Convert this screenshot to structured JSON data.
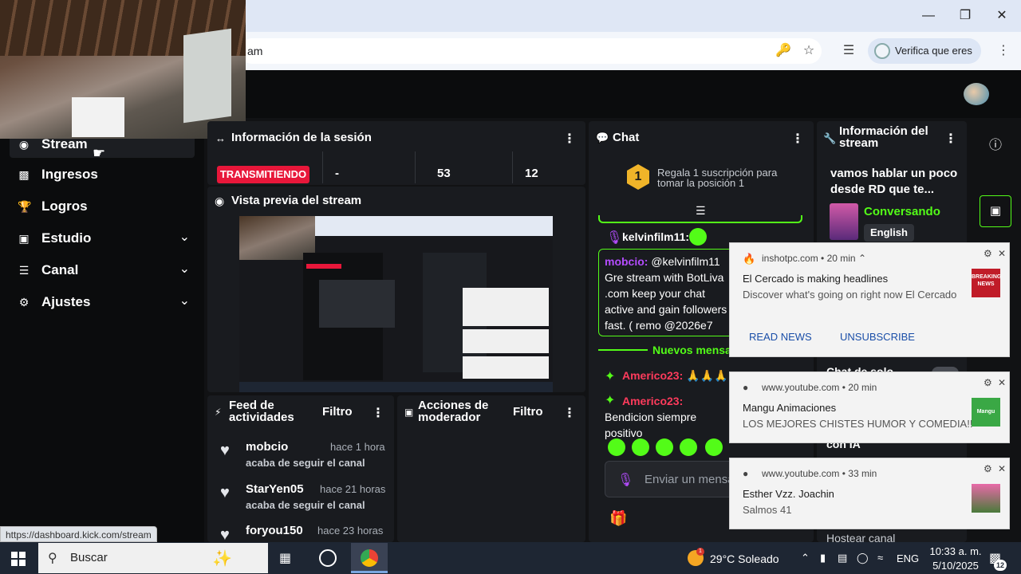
{
  "browser": {
    "url_fragment": "am",
    "verify_label": "Verifica que eres tú",
    "window_controls": [
      "minimize",
      "restore",
      "close"
    ],
    "status_url": "https://dashboard.kick.com/stream"
  },
  "sidebar": {
    "items": [
      {
        "label": "Stream",
        "icon": "broadcast-icon",
        "expandable": false
      },
      {
        "label": "Ingresos",
        "icon": "chart-icon",
        "expandable": false
      },
      {
        "label": "Logros",
        "icon": "trophy-icon",
        "expandable": false
      },
      {
        "label": "Estudio",
        "icon": "studio-icon",
        "expandable": true
      },
      {
        "label": "Canal",
        "icon": "channel-icon",
        "expandable": true
      },
      {
        "label": "Ajustes",
        "icon": "gear-icon",
        "expandable": true
      }
    ]
  },
  "session": {
    "title": "Información de la sesión",
    "live_badge": "TRANSMITIENDO",
    "stats": [
      "-",
      "53",
      "12"
    ]
  },
  "preview": {
    "title": "Vista previa del stream"
  },
  "activity": {
    "title": "Feed de actividades",
    "filter": "Filtro",
    "items": [
      {
        "name": "mobcio",
        "time": "hace 1 hora",
        "desc": "acaba de seguir el canal"
      },
      {
        "name": "StarYen05",
        "time": "hace 21 horas",
        "desc": "acaba de seguir el canal"
      },
      {
        "name": "foryou150",
        "time": "hace 23 horas",
        "desc": ""
      }
    ]
  },
  "moderator": {
    "title": "Acciones de moderador",
    "filter": "Filtro"
  },
  "chat": {
    "title": "Chat",
    "gift_rank": "1",
    "gift_text": "Regala 1 suscripción para tomar la posición 1",
    "messages": [
      {
        "user": "kelvinfilm11:",
        "text": ""
      },
      {
        "user": "mobcio:",
        "text": "@kelvinfilm11 Gre stream with BotLiva .com keep your chat active and gain followers fast. ( remo @2026e7"
      },
      {
        "user": "Americo23:",
        "text": "🙏🙏🙏"
      },
      {
        "user": "Americo23:",
        "text": "Bendicion siempre positivo"
      }
    ],
    "new_messages_label": "Nuevos mensa",
    "input_placeholder": "Enviar un mensa"
  },
  "stream_info": {
    "title": "Información del stream",
    "stream_title": "vamos hablar un poco desde RD que te...",
    "category": "Conversando",
    "language": "English",
    "partial_labels": [
      "Chat de solo",
      "con IA",
      "Hostear canal"
    ]
  },
  "notifications": [
    {
      "source": "inshotpc.com",
      "age": "20 min",
      "title": "El Cercado is making headlines",
      "body": "Discover what's going on right now  El Cercado",
      "actions": [
        "READ NEWS",
        "UNSUBSCRIBE"
      ],
      "thumb": "BREAKING NEWS"
    },
    {
      "source": "www.youtube.com",
      "age": "20 min",
      "title": "Mangu Animaciones",
      "body": "LOS MEJORES CHISTES HUMOR Y COMEDIA!!",
      "actions": [],
      "thumb": "Mangu"
    },
    {
      "source": "www.youtube.com",
      "age": "33 min",
      "title": "Esther Vzz. Joachin",
      "body": "Salmos 41",
      "actions": [],
      "thumb": ""
    }
  ],
  "taskbar": {
    "search_placeholder": "Buscar",
    "weather": "29°C  Soleado",
    "weather_badge": "1",
    "language": "ENG",
    "time": "10:33 a. m.",
    "date": "5/10/2025",
    "notification_count": "12"
  },
  "colors": {
    "accent": "#53fc18",
    "live": "#e8173a",
    "username_red": "#ff3b5c",
    "username_purple": "#b44cff"
  }
}
